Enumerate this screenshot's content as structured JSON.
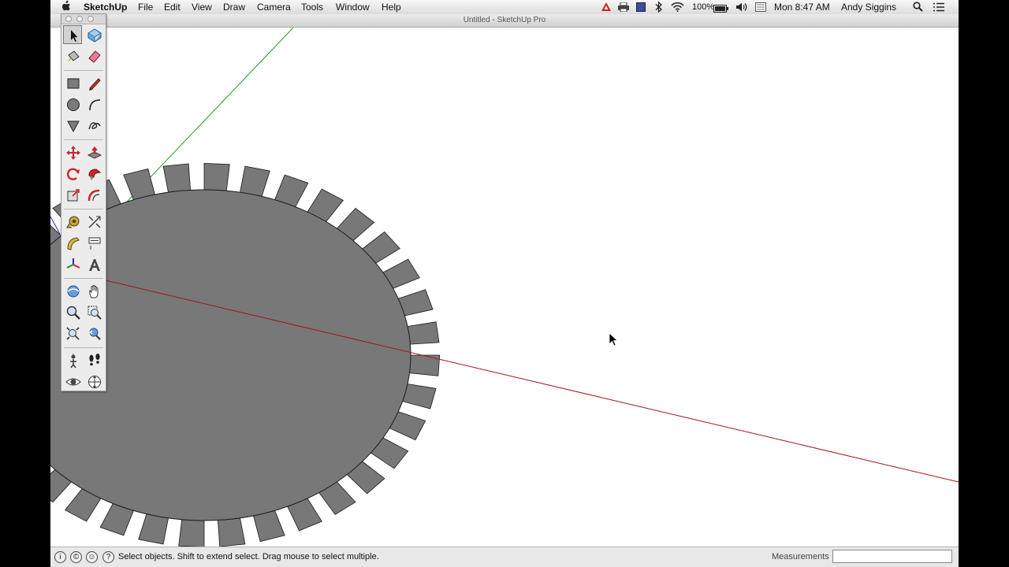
{
  "menubar": {
    "app": "SketchUp",
    "items": [
      "File",
      "Edit",
      "View",
      "Draw",
      "Camera",
      "Tools",
      "Window",
      "Help"
    ],
    "battery": "100%",
    "clock": "Mon 8:47 AM",
    "user": "Andy Siggins"
  },
  "window": {
    "title": "Untitled - SketchUp Pro"
  },
  "status": {
    "text": "Select objects. Shift to extend select. Drag mouse to select multiple.",
    "measurements_label": "Measurements",
    "measurements_value": ""
  },
  "toolbar": {
    "active_tool": "select",
    "tools": [
      "select",
      "make-component",
      "paint-bucket",
      "eraser",
      "rectangle",
      "line",
      "circle",
      "arc",
      "polygon",
      "freehand",
      "move",
      "push-pull",
      "rotate",
      "follow-me",
      "scale",
      "offset",
      "tape-measure",
      "dimension",
      "protractor",
      "text",
      "axes",
      "3d-text",
      "orbit",
      "pan",
      "zoom",
      "zoom-window",
      "zoom-extents",
      "previous-view",
      "position-camera",
      "walk",
      "look-around",
      "section-plane"
    ]
  },
  "colors": {
    "model_face": "#787878",
    "red_axis": "#a31616",
    "green_axis": "#1f9a1f",
    "blue_axis": "#2a2acc"
  }
}
